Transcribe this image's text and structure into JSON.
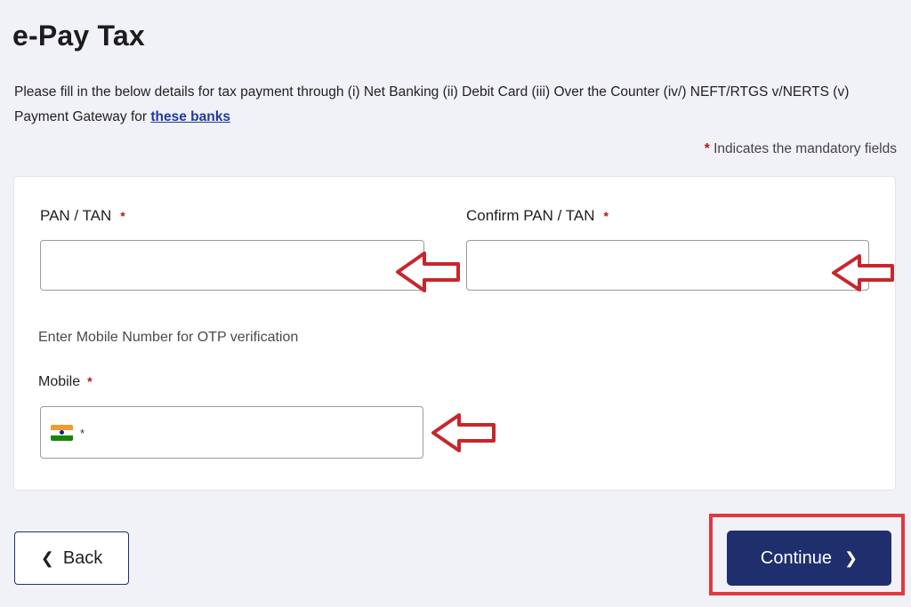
{
  "page": {
    "title": "e-Pay Tax",
    "intro_text": "Please fill in the below details for tax payment through (i) Net Banking (ii) Debit Card (iii) Over the Counter (iv/) NEFT/RTGS v/NERTS (v) Payment Gateway for ",
    "intro_link": "these banks",
    "mandatory_star": "*",
    "mandatory_note": "Indicates the mandatory fields"
  },
  "form": {
    "pan_label": "PAN / TAN",
    "pan_value": "",
    "pan_placeholder": "",
    "confirm_pan_label": "Confirm PAN / TAN",
    "confirm_pan_value": "",
    "confirm_pan_placeholder": "",
    "otp_hint": "Enter Mobile Number for OTP verification",
    "mobile_label": "Mobile",
    "mobile_prefix_star": "*",
    "mobile_value": "",
    "required_star": "*"
  },
  "footer": {
    "back_label": "Back",
    "continue_label": "Continue"
  },
  "icons": {
    "back": "chevron-left-icon",
    "continue": "chevron-right-icon",
    "flag": "india-flag-icon",
    "annotation": "red-arrow-left-icon"
  },
  "colors": {
    "primary_button": "#1f2f6e",
    "required_star": "#b3161b",
    "link": "#1e3a9e",
    "annotation_red": "#c8262c",
    "highlight_box": "#e0393f",
    "page_background": "#f1f1f8"
  }
}
